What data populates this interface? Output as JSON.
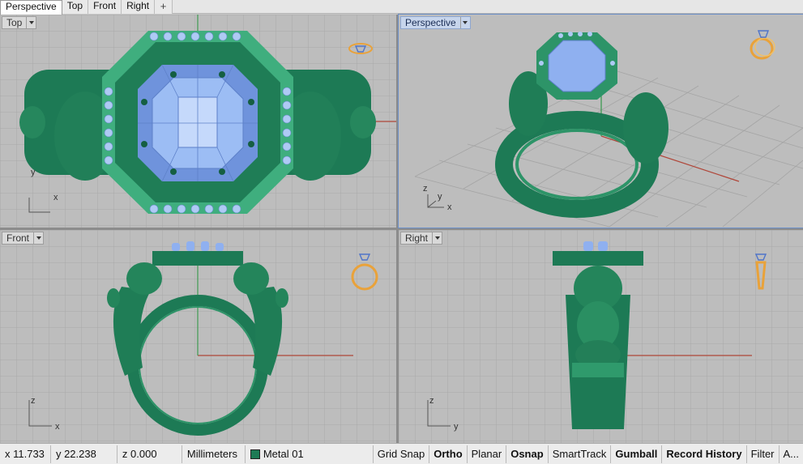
{
  "tabs": [
    "Perspective",
    "Top",
    "Front",
    "Right"
  ],
  "tab_add_symbol": "+",
  "viewports": {
    "top": {
      "label": "Top",
      "axis_a": "y",
      "axis_b": "x"
    },
    "perspective": {
      "label": "Perspective",
      "axis_a": "z",
      "axis_b": "y",
      "axis_c": "x"
    },
    "front": {
      "label": "Front",
      "axis_a": "z",
      "axis_b": "x"
    },
    "right": {
      "label": "Right",
      "axis_a": "z",
      "axis_b": "y"
    }
  },
  "status": {
    "x": "x 11.733",
    "y": "y 22.238",
    "z": "z 0.000",
    "units": "Millimeters",
    "layer": "Metal 01",
    "buttons": [
      {
        "label": "Grid Snap",
        "bold": false
      },
      {
        "label": "Ortho",
        "bold": true
      },
      {
        "label": "Planar",
        "bold": false
      },
      {
        "label": "Osnap",
        "bold": true
      },
      {
        "label": "SmartTrack",
        "bold": false
      },
      {
        "label": "Gumball",
        "bold": true
      },
      {
        "label": "Record History",
        "bold": true
      },
      {
        "label": "Filter",
        "bold": false
      },
      {
        "label": "A...",
        "bold": false
      }
    ]
  },
  "colors": {
    "metal": "#1d7a55",
    "metal_light": "#2f9a6c",
    "gem": "#8fb0f0",
    "grid": "#a9a9a9",
    "viewport_bg": "#bdbdbd",
    "axis_red": "#b0473a",
    "axis_green": "#3f9a52",
    "icon": "#e9a23a"
  },
  "icons": [
    "ring-top-icon",
    "ring-persp-icon",
    "ring-front-icon",
    "ring-right-icon"
  ]
}
